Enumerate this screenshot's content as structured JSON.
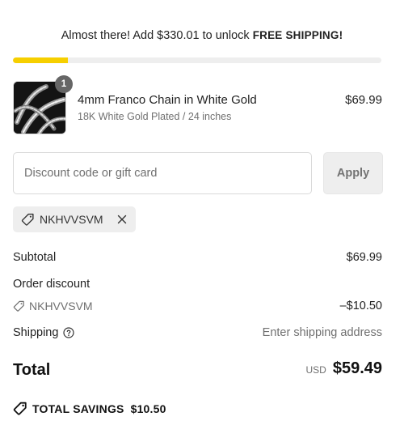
{
  "shipping_banner": {
    "message": "Almost there! Add $330.01 to unlock",
    "highlight": "FREE SHIPPING!",
    "progress": 0.15,
    "accent_color": "#f6cf00"
  },
  "line_item": {
    "quantity": "1",
    "title": "4mm Franco Chain in White Gold",
    "variant": "18K White Gold Plated / 24 inches",
    "price": "$69.99",
    "image_icon": "chain-necklace-thumbnail"
  },
  "discount": {
    "placeholder": "Discount code or gift card",
    "value": "",
    "apply_label": "Apply",
    "applied_code": "NKHVVSVM"
  },
  "summary": {
    "subtotal_label": "Subtotal",
    "subtotal_value": "$69.99",
    "order_discount_label": "Order discount",
    "order_discount_code": "NKHVVSVM",
    "order_discount_value": "–$10.50",
    "shipping_label": "Shipping",
    "shipping_value": "Enter shipping address",
    "total_label": "Total",
    "currency": "USD",
    "total_value": "$59.49",
    "savings_label": "TOTAL SAVINGS",
    "savings_value": "$10.50"
  }
}
